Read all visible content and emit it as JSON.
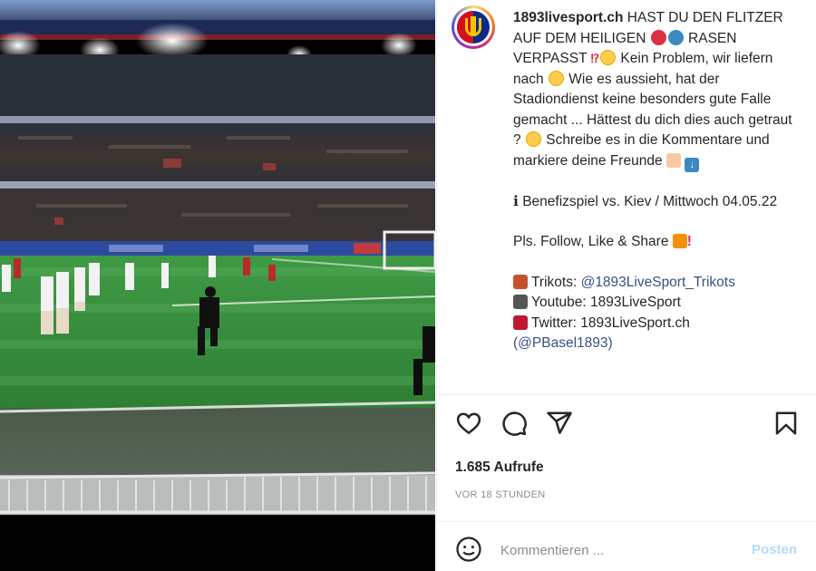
{
  "post": {
    "username": "1893livesport.ch",
    "caption": {
      "line1": "HAST DU DEN FLITZER AUF DEM HEILIGEN",
      "line1b": "RASEN VERPASST",
      "line2": "Kein Problem, wir liefern nach",
      "line3": "Wie es aussieht, hat der Stadiondienst keine besonders gute Falle gemacht ... Hättest du dich dies auch getraut ?",
      "line4": "Schreibe es in die Kommentare und markiere deine Freunde",
      "info_prefix": "ℹ",
      "info": "Benefizspiel vs. Kiev / Mittwoch 04.05.22",
      "follow": "Pls. Follow, Like & Share",
      "trikots_label": "Trikots: ",
      "trikots_link": "@1893LiveSport_Trikots",
      "youtube": "Youtube: 1893LiveSport",
      "twitter": "Twitter: 1893LiveSport.ch",
      "more": "(@PBasel1893)"
    },
    "views": "1.685 Aufrufe",
    "time_ago": "VOR 18 STUNDEN",
    "comment": {
      "placeholder": "Kommentieren ...",
      "post_label": "Posten"
    },
    "icons": {
      "like": "heart-icon",
      "comment": "comment-icon",
      "share": "paper-plane-icon",
      "save": "bookmark-icon",
      "emoji": "smiley-icon"
    },
    "colors": {
      "link": "#385185",
      "post_button": "#b3dbff",
      "meta": "#8e8e8e"
    }
  }
}
